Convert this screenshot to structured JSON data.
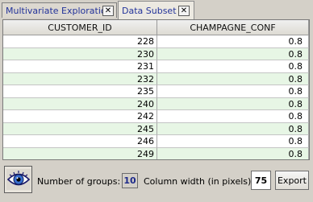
{
  "tabs": [
    {
      "label": "Multivariate Exploration",
      "active": false
    },
    {
      "label": "Data Subset",
      "active": true
    }
  ],
  "table": {
    "columns": [
      "CUSTOMER_ID",
      "CHAMPAGNE_CONF"
    ],
    "rows": [
      [
        "228",
        "0.8"
      ],
      [
        "230",
        "0.8"
      ],
      [
        "231",
        "0.8"
      ],
      [
        "232",
        "0.8"
      ],
      [
        "235",
        "0.8"
      ],
      [
        "240",
        "0.8"
      ],
      [
        "242",
        "0.8"
      ],
      [
        "245",
        "0.8"
      ],
      [
        "246",
        "0.8"
      ],
      [
        "249",
        "0.8"
      ]
    ]
  },
  "toolbar": {
    "eye_icon": "eye-icon",
    "groups_label": "Number of groups:",
    "groups_value": "10",
    "column_width_label": "Column width (in pixels)",
    "column_width_value": "75",
    "export_label": "Export"
  },
  "colors": {
    "row_alt": "#e7f6e5",
    "tab_text": "#23339a",
    "groups_value": "#1d2a8a"
  }
}
